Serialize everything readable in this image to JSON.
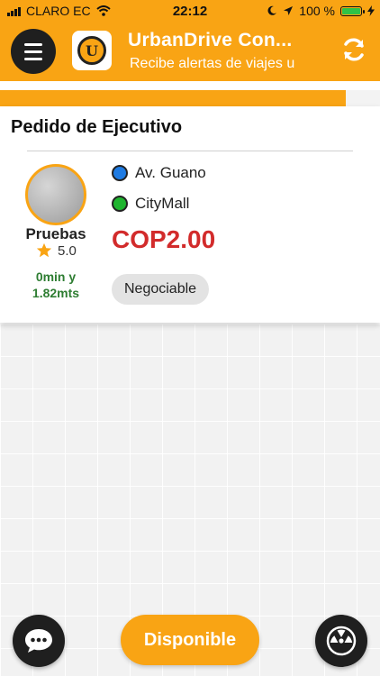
{
  "status_bar": {
    "carrier": "CLARO EC",
    "time": "22:12",
    "battery": "100 %"
  },
  "header": {
    "title": "UrbanDrive Con...",
    "subtitle": "Recibe alertas de viajes u",
    "logo_letter": "U",
    "menu_icon": "hamburger-menu-icon",
    "refresh_icon": "refresh-icon"
  },
  "progress": {
    "value": 0.91,
    "color": "#f9a414"
  },
  "order": {
    "title": "Pedido de Ejecutivo",
    "passenger_name": "Pruebas",
    "rating": "5.0",
    "eta_time": "0min y",
    "eta_distance": "1.82mts",
    "origin": "Av. Guano",
    "origin_color": "#1e7be3",
    "destination": "CityMall",
    "destination_color": "#1fb52f",
    "price": "COP2.00",
    "price_type": "Negociable"
  },
  "bottom": {
    "available_label": "Disponible",
    "chat_icon": "chat-bubble-icon",
    "panic_icon": "radiation-alert-icon"
  },
  "colors": {
    "brand": "#f9a414",
    "dark": "#1f1f1f",
    "price": "#d22b2b",
    "eta": "#2e7d32"
  }
}
